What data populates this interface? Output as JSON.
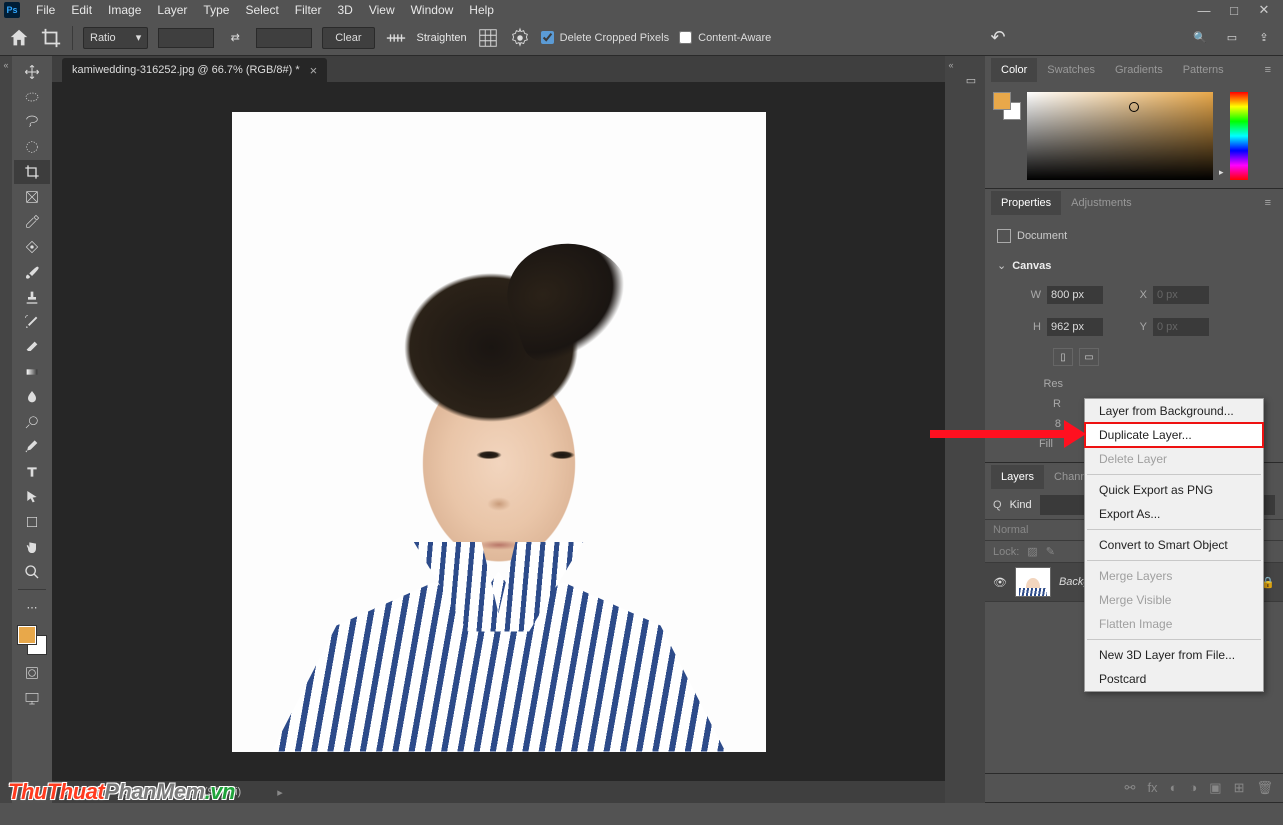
{
  "app": {
    "logo": "Ps"
  },
  "menubar": [
    "File",
    "Edit",
    "Image",
    "Layer",
    "Type",
    "Select",
    "Filter",
    "3D",
    "View",
    "Window",
    "Help"
  ],
  "window_controls": {
    "min": "—",
    "max": "□",
    "close": "✕"
  },
  "options": {
    "ratio_label": "Ratio",
    "ratio_arrow": "▾",
    "swap": "⇄",
    "clear": "Clear",
    "straighten": "Straighten",
    "delete_cropped": "Delete Cropped Pixels",
    "content_aware": "Content-Aware",
    "undo": "↶"
  },
  "right_icons": {
    "search": "🔍",
    "layout": "▭",
    "share": "⇪"
  },
  "document": {
    "tab_title": "kamiwedding-316252.jpg @ 66.7% (RGB/8#) *"
  },
  "statusbar": {
    "zoom": "66.7%",
    "dims": "800 px x 962 px (96 ppi)"
  },
  "panels": {
    "color": {
      "tabs": [
        "Color",
        "Swatches",
        "Gradients",
        "Patterns"
      ]
    },
    "properties": {
      "tabs": [
        "Properties",
        "Adjustments"
      ],
      "doc_label": "Document",
      "canvas_label": "Canvas",
      "w_label": "W",
      "w_val": "800 px",
      "h_label": "H",
      "h_val": "962 px",
      "x_label": "X",
      "x_val": "0 px",
      "y_label": "Y",
      "y_val": "0 px",
      "res_label": "Res",
      "r_label": "R",
      "eight": "8",
      "fill_label": "Fill"
    },
    "layers": {
      "tabs": [
        "Layers",
        "Chann"
      ],
      "kind_label": "Kind",
      "search_placeholder": "",
      "blend": "Normal",
      "lock_label": "Lock:",
      "bg_name": "Background"
    }
  },
  "context_menu": {
    "items": [
      {
        "label": "Layer from Background...",
        "enabled": true
      },
      {
        "label": "Duplicate Layer...",
        "enabled": true,
        "highlight": true
      },
      {
        "label": "Delete Layer",
        "enabled": false
      },
      {
        "sep": true
      },
      {
        "label": "Quick Export as PNG",
        "enabled": true
      },
      {
        "label": "Export As...",
        "enabled": true
      },
      {
        "sep": true
      },
      {
        "label": "Convert to Smart Object",
        "enabled": true
      },
      {
        "sep": true
      },
      {
        "label": "Merge Layers",
        "enabled": false
      },
      {
        "label": "Merge Visible",
        "enabled": false
      },
      {
        "label": "Flatten Image",
        "enabled": false
      },
      {
        "sep": true
      },
      {
        "label": "New 3D Layer from File...",
        "enabled": true
      },
      {
        "label": "Postcard",
        "enabled": true
      }
    ]
  },
  "watermark": {
    "p1": "ThuThuat",
    "p2": "PhanMem",
    "p3": ".vn"
  }
}
